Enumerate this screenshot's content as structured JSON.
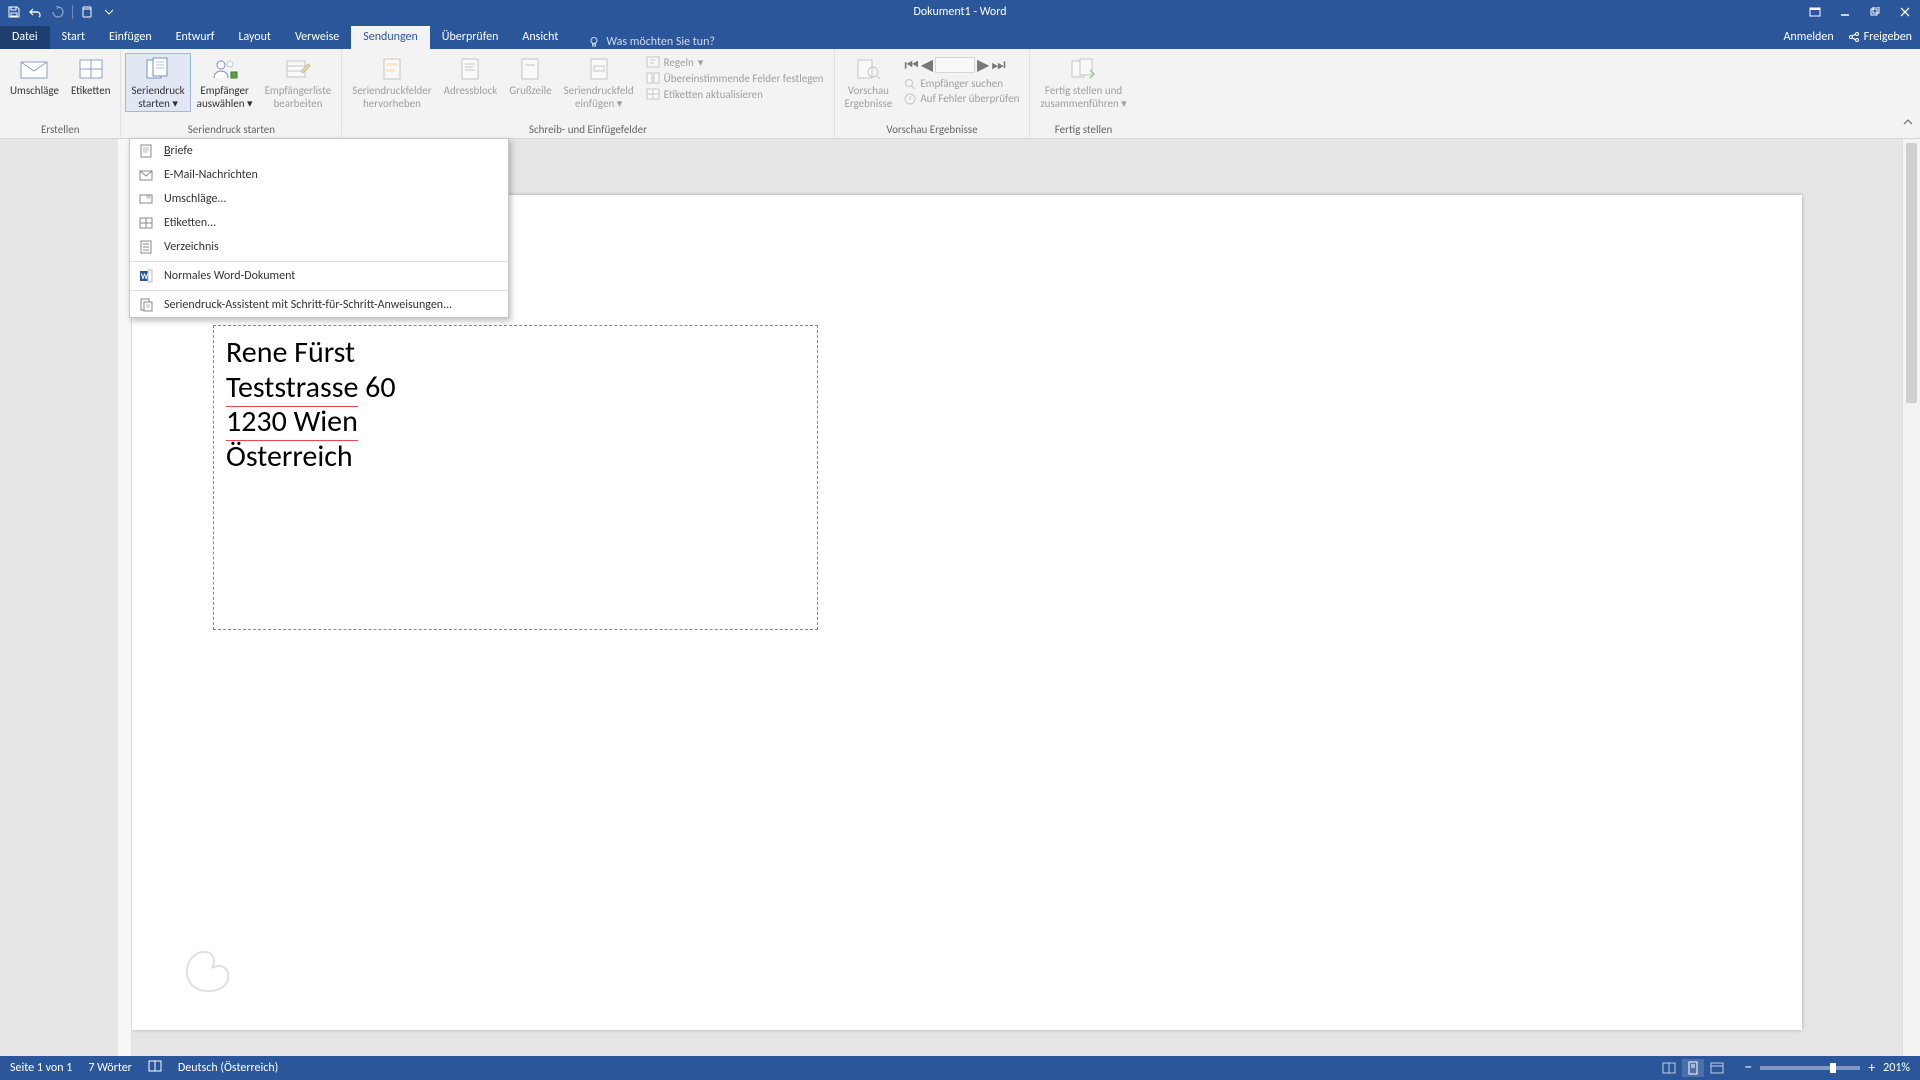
{
  "title": "Dokument1 - Word",
  "tabs": {
    "file": "Datei",
    "start": "Start",
    "insert": "Einfügen",
    "design": "Entwurf",
    "layout": "Layout",
    "references": "Verweise",
    "mailings": "Sendungen",
    "review": "Überprüfen",
    "view": "Ansicht"
  },
  "tell_me_placeholder": "Was möchten Sie tun?",
  "header_right": {
    "signin": "Anmelden",
    "share": "Freigeben"
  },
  "ribbon": {
    "groups": {
      "create": {
        "label": "Erstellen",
        "envelopes": "Umschläge",
        "labels": "Etiketten"
      },
      "start_mm": {
        "label": "Seriendruck starten",
        "start_l1": "Seriendruck",
        "start_l2": "starten",
        "select_l1": "Empfänger",
        "select_l2": "auswählen",
        "edit_l1": "Empfängerliste",
        "edit_l2": "bearbeiten"
      },
      "write": {
        "label": "Schreib- und Einfügefelder",
        "highlight_l1": "Seriendruckfelder",
        "highlight_l2": "hervorheben",
        "address": "Adressblock",
        "greeting": "Grußzeile",
        "insert_l1": "Seriendruckfeld",
        "insert_l2": "einfügen",
        "rules": "Regeln",
        "match": "Übereinstimmende Felder festlegen",
        "update": "Etiketten aktualisieren"
      },
      "preview": {
        "label": "Vorschau Ergebnisse",
        "preview_l1": "Vorschau",
        "preview_l2": "Ergebnisse",
        "find": "Empfänger suchen",
        "check": "Auf Fehler überprüfen"
      },
      "finish": {
        "label": "Fertig stellen",
        "finish_l1": "Fertig stellen und",
        "finish_l2": "zusammenführen"
      }
    }
  },
  "dropdown": {
    "briefe": "Briefe",
    "email": "E-Mail-Nachrichten",
    "envelopes": "Umschläge...",
    "labels": "Etiketten...",
    "directory": "Verzeichnis",
    "normal": "Normales Word-Dokument",
    "wizard": "Seriendruck-Assistent mit Schritt-für-Schritt-Anweisungen..."
  },
  "document": {
    "address": {
      "line1": "Rene Fürst",
      "line2a": "Teststrasse",
      "line2b": " 60",
      "line3": "1230 Wien",
      "line4": "Österreich"
    }
  },
  "status": {
    "page": "Seite 1 von 1",
    "words": "7 Wörter",
    "lang": "Deutsch (Österreich)",
    "zoom": "201%"
  }
}
